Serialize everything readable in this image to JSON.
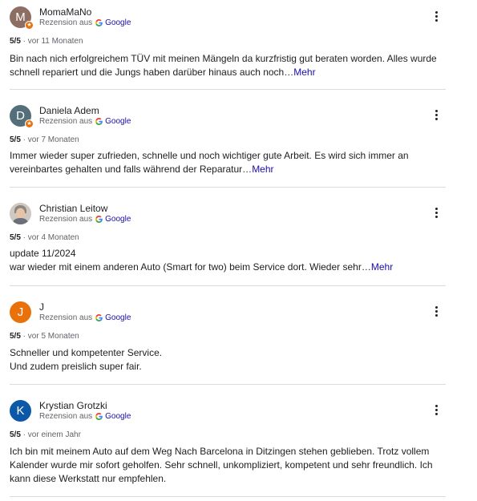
{
  "colors": {
    "avatar_1": "#8d6e63",
    "avatar_2": "#546e7a",
    "avatar_4": "#e8710a",
    "avatar_5": "#0b57a8",
    "link": "#1a0dab",
    "muted": "#5f6368"
  },
  "icons": {
    "menu": "more-vert-icon",
    "google": "google-g-icon",
    "guide_badge": "local-guide-star-icon"
  },
  "reviews": [
    {
      "initial": "M",
      "name": "MomaMaNo",
      "source_prefix": "Rezension aus",
      "source_name": "Google",
      "rating": "5/5",
      "time": "vor 11 Monaten",
      "text": "Bin nach nich erfolgreichem TÜV mit meinen Mängeln da kurzfristig gut beraten worden. Alles wurde schnell repariert und die Jungs haben darüber hinaus auch noch…",
      "more": "Mehr"
    },
    {
      "initial": "D",
      "name": "Daniela Adem",
      "source_prefix": "Rezension aus",
      "source_name": "Google",
      "rating": "5/5",
      "time": "vor 7 Monaten",
      "text": "Immer wieder super zufrieden, schnelle und noch wichtiger gute Arbeit. Es wird sich immer an vereinbartes gehalten und falls während der Reparatur…",
      "more": "Mehr"
    },
    {
      "initial": "",
      "name": "Christian Leitow",
      "source_prefix": "Rezension aus",
      "source_name": "Google",
      "rating": "5/5",
      "time": "vor 4 Monaten",
      "text_line1": "update 11/2024",
      "text": "war wieder mit einem anderen Auto (Smart for two) beim Service dort. Wieder sehr…",
      "more": "Mehr"
    },
    {
      "initial": "J",
      "name": "J",
      "source_prefix": "Rezension aus",
      "source_name": "Google",
      "rating": "5/5",
      "time": "vor 5 Monaten",
      "text_line1": "Schneller und kompetenter Service.",
      "text_line2": "Und zudem preislich super fair."
    },
    {
      "initial": "K",
      "name": "Krystian Grotzki",
      "source_prefix": "Rezension aus",
      "source_name": "Google",
      "rating": "5/5",
      "time": "vor einem Jahr",
      "text": "Ich bin mit meinem Auto auf dem Weg Nach Barcelona in Ditzingen stehen geblieben. Trotz vollem Kalender wurde mir sofort geholfen. Sehr schnell, unkompliziert, kompetent und sehr freundlich. Ich kann diese Werkstatt nur empfehlen."
    }
  ]
}
